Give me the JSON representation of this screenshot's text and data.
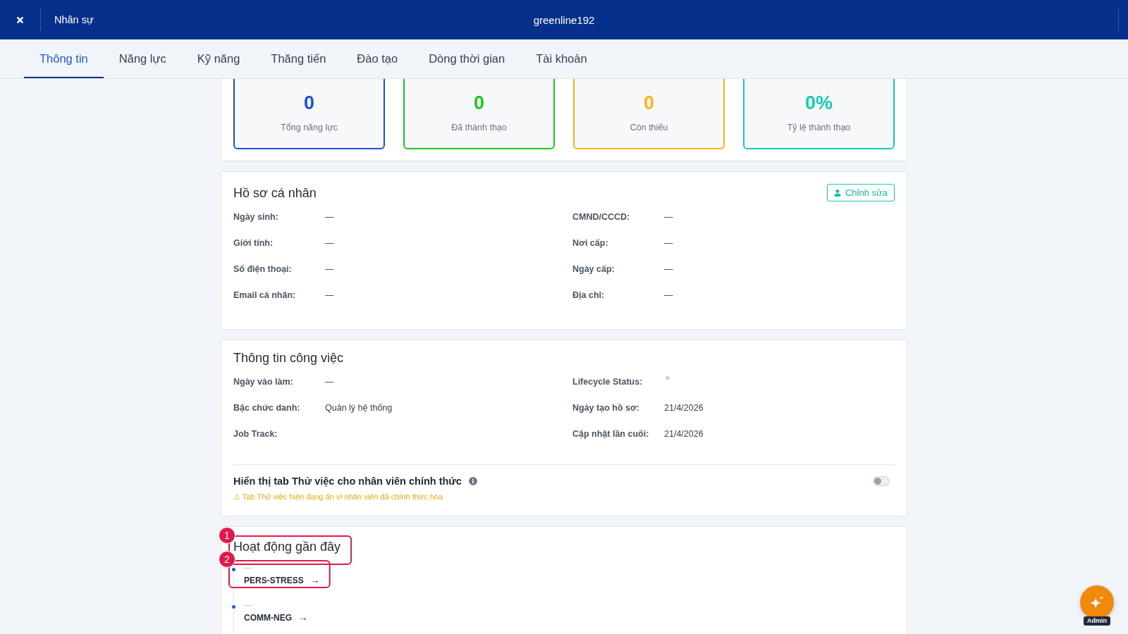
{
  "header": {
    "section": "Nhân sự",
    "title": "greenline192"
  },
  "tabs": [
    {
      "label": "Thông tin",
      "selected": true
    },
    {
      "label": "Năng lực",
      "selected": false
    },
    {
      "label": "Kỹ năng",
      "selected": false
    },
    {
      "label": "Thăng tiến",
      "selected": false
    },
    {
      "label": "Đào tạo",
      "selected": false
    },
    {
      "label": "Dòng thời gian",
      "selected": false
    },
    {
      "label": "Tài khoản",
      "selected": false
    }
  ],
  "stats": [
    {
      "value": "0",
      "label": "Tổng năng lực",
      "color": "#1f4fd8"
    },
    {
      "value": "0",
      "label": "Đã thành thạo",
      "color": "#19c91e"
    },
    {
      "value": "0",
      "label": "Còn thiếu",
      "color": "#fbb414"
    },
    {
      "value": "0%",
      "label": "Tỷ lệ thành thạo",
      "color": "#13cdb4"
    }
  ],
  "profile": {
    "title": "Hồ sơ cá nhân",
    "edit_button": "Chỉnh sửa",
    "columns": [
      {
        "fields": [
          {
            "kind": "text",
            "label": "Ngày sinh:",
            "value": "—"
          },
          {
            "kind": "text",
            "label": "Giới tính:",
            "value": "—"
          },
          {
            "kind": "text",
            "label": "Số điện thoại:",
            "value": "—"
          },
          {
            "kind": "text",
            "label": "Email cá nhân:",
            "value": "—"
          }
        ]
      },
      {
        "fields": [
          {
            "kind": "text",
            "label": "CMND/CCCD:",
            "value": "—"
          },
          {
            "kind": "text",
            "label": "Nơi cấp:",
            "value": "—"
          },
          {
            "kind": "text",
            "label": "Ngày cấp:",
            "value": "—"
          },
          {
            "kind": "text",
            "label": "Địa chỉ:",
            "value": "—"
          }
        ]
      }
    ]
  },
  "work": {
    "title": "Thông tin công việc",
    "columns": [
      {
        "fields": [
          {
            "kind": "text",
            "label": "Ngày vào làm:",
            "value": "—"
          },
          {
            "kind": "text",
            "label": "Bậc chức danh:",
            "value": "Quản lý hệ thống"
          },
          {
            "kind": "text",
            "label": "Job Track:"
          }
        ]
      },
      {
        "fields": [
          {
            "kind": "status",
            "label": "Lifecycle Status:"
          },
          {
            "kind": "text",
            "label": "Ngày tạo hồ sơ:",
            "value": "21/4/2026"
          },
          {
            "kind": "text",
            "label": "Cập nhật lần cuối:",
            "value": "21/4/2026"
          }
        ]
      }
    ],
    "toggle": {
      "label": "Hiển thị tab Thử việc cho nhân viên chính thức",
      "on": false,
      "note": "⚠ Tab Thử việc hiện đang ẩn vì nhân viên đã chính thức hóa"
    }
  },
  "activity": {
    "title": "Hoạt động gần đây",
    "title_marker": "1",
    "items": [
      {
        "time": "—",
        "code": "PERS-STRESS",
        "arrow": "→",
        "marker": "2"
      },
      {
        "time": "—",
        "code": "COMM-NEG",
        "arrow": "→"
      }
    ]
  },
  "assistant": {
    "badge": "Admin"
  }
}
